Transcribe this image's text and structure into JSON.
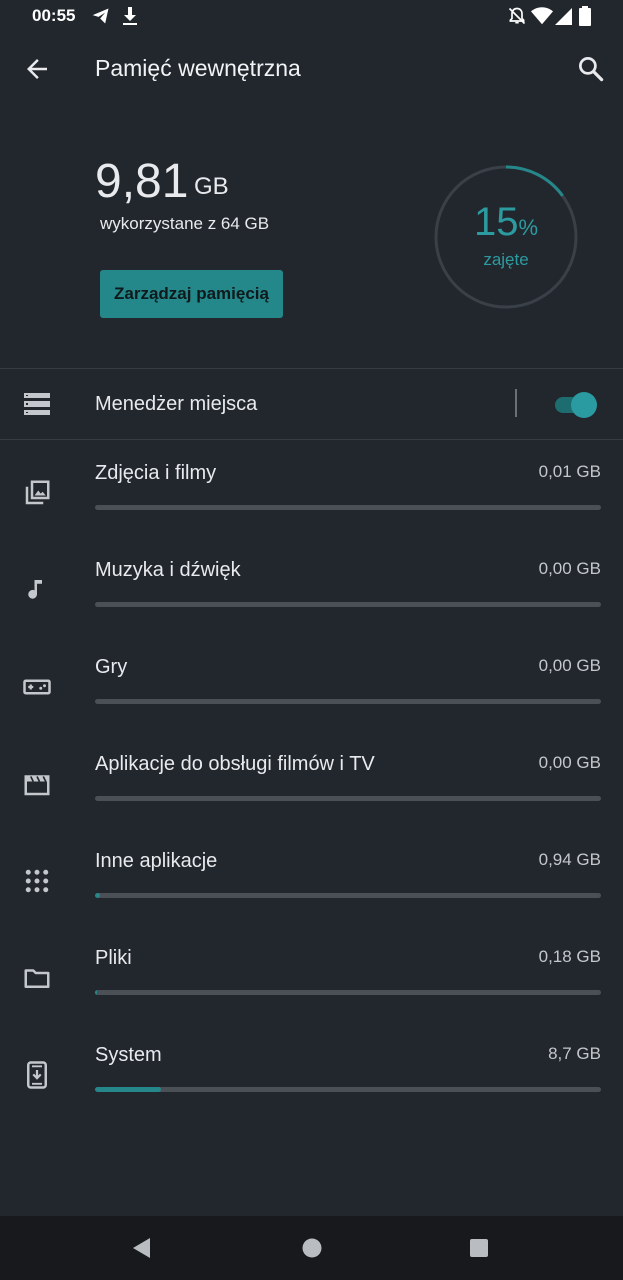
{
  "status_bar": {
    "time": "00:55",
    "left_icons": [
      "telegram-icon",
      "download-icon"
    ],
    "right_icons": [
      "notifications-off-icon",
      "wifi-icon",
      "signal-icon",
      "battery-icon"
    ]
  },
  "app_bar": {
    "title": "Pamięć wewnętrzna",
    "back_icon": "arrow-back-icon",
    "search_icon": "search-icon"
  },
  "summary": {
    "used_value": "9,81",
    "used_unit": "GB",
    "used_of": "wykorzystane z 64 GB",
    "manage_button": "Zarządzaj pamięcią",
    "percent_number": "15",
    "percent_sign": "%",
    "percent_label": "zajęte",
    "percent_used": 0.15
  },
  "space_manager": {
    "label": "Menedżer miejsca",
    "enabled": true
  },
  "categories": [
    {
      "label": "Zdjęcia i filmy",
      "size": "0,01 GB",
      "fraction": 0.0,
      "icon": "photo-library-icon"
    },
    {
      "label": "Muzyka i dźwięk",
      "size": "0,00 GB",
      "fraction": 0.0,
      "icon": "music-note-icon"
    },
    {
      "label": "Gry",
      "size": "0,00 GB",
      "fraction": 0.0,
      "icon": "gamepad-icon"
    },
    {
      "label": "Aplikacje do obsługi filmów i TV",
      "size": "0,00 GB",
      "fraction": 0.0,
      "icon": "movie-icon"
    },
    {
      "label": "Inne aplikacje",
      "size": "0,94 GB",
      "fraction": 0.01,
      "icon": "apps-grid-icon"
    },
    {
      "label": "Pliki",
      "size": "0,18 GB",
      "fraction": 0.003,
      "icon": "folder-icon"
    },
    {
      "label": "System",
      "size": "8,7 GB",
      "fraction": 0.13,
      "icon": "system-update-icon"
    }
  ],
  "colors": {
    "accent": "#26878a",
    "background": "#22272d",
    "navbar": "#17191c"
  },
  "nav_bar": {
    "icons": [
      "nav-back-icon",
      "nav-home-icon",
      "nav-recents-icon"
    ]
  }
}
